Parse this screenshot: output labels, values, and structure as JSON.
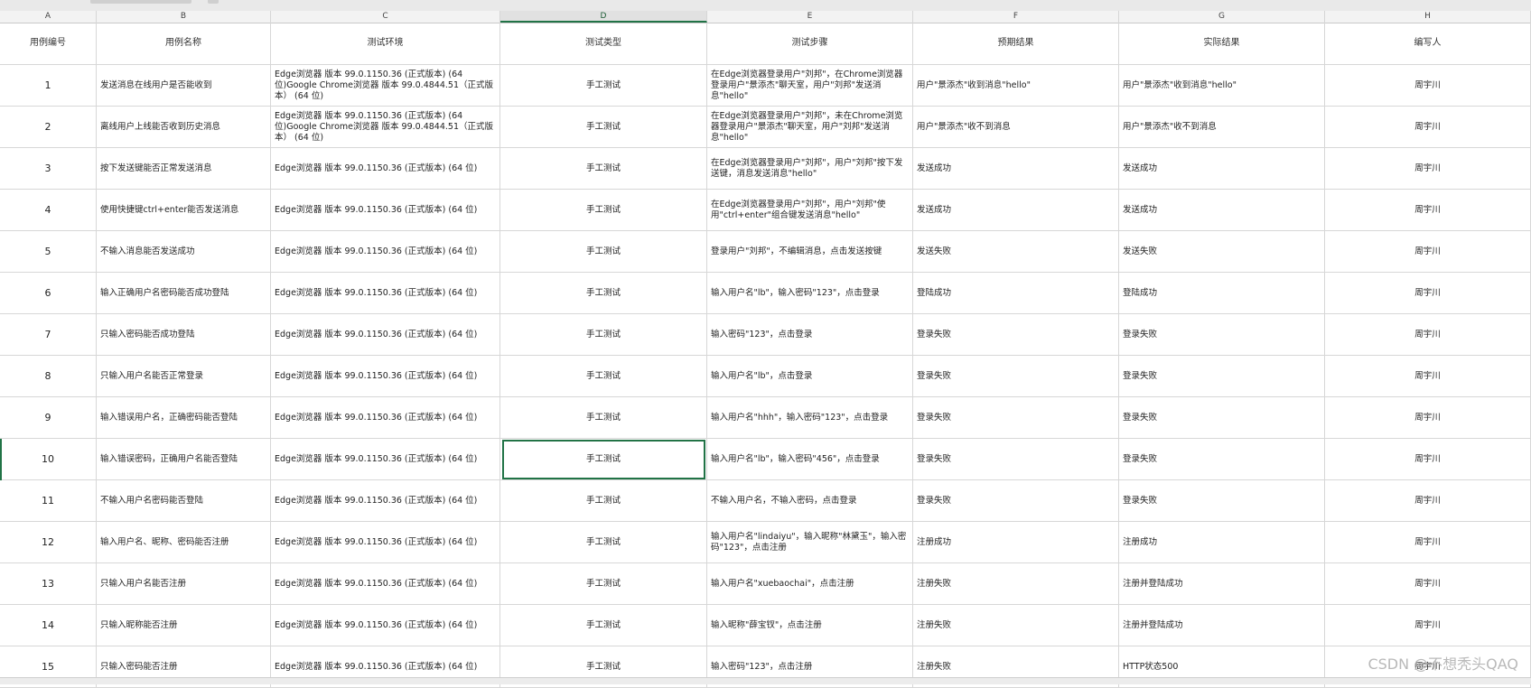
{
  "column_letters": [
    "A",
    "B",
    "C",
    "D",
    "E",
    "F",
    "G",
    "H"
  ],
  "selected_column": "D",
  "headers": [
    "用例编号",
    "用例名称",
    "测试环境",
    "测试类型",
    "测试步骤",
    "预期结果",
    "实际结果",
    "编写人"
  ],
  "rows": [
    {
      "id": "1",
      "name": "发送消息在线用户是否能收到",
      "env": "Edge浏览器 版本 99.0.1150.36 (正式版本) (64 位)Google Chrome浏览器 版本 99.0.4844.51（正式版本） (64 位)",
      "type": "手工测试",
      "steps": "在Edge浏览器登录用户\"刘邦\"，在Chrome浏览器登录用户\"景添杰\"聊天室，用户\"刘邦\"发送消息\"hello\"",
      "expected": "用户\"景添杰\"收到消息\"hello\"",
      "actual": "用户\"景添杰\"收到消息\"hello\"",
      "author": "周宇川"
    },
    {
      "id": "2",
      "name": "离线用户上线能否收到历史消息",
      "env": "Edge浏览器 版本 99.0.1150.36 (正式版本) (64 位)Google Chrome浏览器 版本 99.0.4844.51（正式版本） (64 位)",
      "type": "手工测试",
      "steps": "在Edge浏览器登录用户\"刘邦\"，未在Chrome浏览器登录用户\"景添杰\"聊天室，用户\"刘邦\"发送消息\"hello\"",
      "expected": "用户\"景添杰\"收不到消息",
      "actual": "用户\"景添杰\"收不到消息",
      "author": "周宇川"
    },
    {
      "id": "3",
      "name": "按下发送键能否正常发送消息",
      "env": "Edge浏览器 版本 99.0.1150.36 (正式版本) (64 位)",
      "type": "手工测试",
      "steps": "在Edge浏览器登录用户\"刘邦\"，用户\"刘邦\"按下发送键，消息发送消息\"hello\"",
      "expected": "发送成功",
      "actual": "发送成功",
      "author": "周宇川"
    },
    {
      "id": "4",
      "name": "使用快捷键ctrl+enter能否发送消息",
      "env": "Edge浏览器 版本 99.0.1150.36 (正式版本) (64 位)",
      "type": "手工测试",
      "steps": "在Edge浏览器登录用户\"刘邦\"，用户\"刘邦\"使用\"ctrl+enter\"组合键发送消息\"hello\"",
      "expected": "发送成功",
      "actual": "发送成功",
      "author": "周宇川"
    },
    {
      "id": "5",
      "name": "不输入消息能否发送成功",
      "env": "Edge浏览器 版本 99.0.1150.36 (正式版本) (64 位)",
      "type": "手工测试",
      "steps": "登录用户\"刘邦\"，不编辑消息，点击发送按键",
      "expected": "发送失败",
      "actual": "发送失败",
      "author": "周宇川"
    },
    {
      "id": "6",
      "name": "输入正确用户名密码能否成功登陆",
      "env": "Edge浏览器 版本 99.0.1150.36 (正式版本) (64 位)",
      "type": "手工测试",
      "steps": "输入用户名\"lb\"，输入密码\"123\"，点击登录",
      "expected": "登陆成功",
      "actual": "登陆成功",
      "author": "周宇川"
    },
    {
      "id": "7",
      "name": "只输入密码能否成功登陆",
      "env": "Edge浏览器 版本 99.0.1150.36 (正式版本) (64 位)",
      "type": "手工测试",
      "steps": "输入密码\"123\"，点击登录",
      "expected": "登录失败",
      "actual": "登录失败",
      "author": "周宇川"
    },
    {
      "id": "8",
      "name": "只输入用户名能否正常登录",
      "env": "Edge浏览器 版本 99.0.1150.36 (正式版本) (64 位)",
      "type": "手工测试",
      "steps": "输入用户名\"lb\"，点击登录",
      "expected": "登录失败",
      "actual": "登录失败",
      "author": "周宇川"
    },
    {
      "id": "9",
      "name": "输入错误用户名，正确密码能否登陆",
      "env": "Edge浏览器 版本 99.0.1150.36 (正式版本) (64 位)",
      "type": "手工测试",
      "steps": "输入用户名\"hhh\"，输入密码\"123\"，点击登录",
      "expected": "登录失败",
      "actual": "登录失败",
      "author": "周宇川"
    },
    {
      "id": "10",
      "name": "输入错误密码，正确用户名能否登陆",
      "env": "Edge浏览器 版本 99.0.1150.36 (正式版本) (64 位)",
      "type": "手工测试",
      "steps": "输入用户名\"lb\"，输入密码\"456\"，点击登录",
      "expected": "登录失败",
      "actual": "登录失败",
      "author": "周宇川"
    },
    {
      "id": "11",
      "name": "不输入用户名密码能否登陆",
      "env": "Edge浏览器 版本 99.0.1150.36 (正式版本) (64 位)",
      "type": "手工测试",
      "steps": "不输入用户名，不输入密码，点击登录",
      "expected": "登录失败",
      "actual": "登录失败",
      "author": "周宇川"
    },
    {
      "id": "12",
      "name": "输入用户名、昵称、密码能否注册",
      "env": "Edge浏览器 版本 99.0.1150.36 (正式版本) (64 位)",
      "type": "手工测试",
      "steps": "输入用户名\"lindaiyu\"，输入昵称\"林黛玉\"，输入密码\"123\"，点击注册",
      "expected": "注册成功",
      "actual": "注册成功",
      "author": "周宇川"
    },
    {
      "id": "13",
      "name": "只输入用户名能否注册",
      "env": "Edge浏览器 版本 99.0.1150.36 (正式版本) (64 位)",
      "type": "手工测试",
      "steps": "输入用户名\"xuebaochai\"，点击注册",
      "expected": "注册失败",
      "actual": "注册并登陆成功",
      "author": "周宇川"
    },
    {
      "id": "14",
      "name": "只输入昵称能否注册",
      "env": "Edge浏览器 版本 99.0.1150.36 (正式版本) (64 位)",
      "type": "手工测试",
      "steps": "输入昵称\"薛宝钗\"，点击注册",
      "expected": "注册失败",
      "actual": "注册并登陆成功",
      "author": "周宇川"
    },
    {
      "id": "15",
      "name": "只输入密码能否注册",
      "env": "Edge浏览器 版本 99.0.1150.36 (正式版本) (64 位)",
      "type": "手工测试",
      "steps": "输入密码\"123\"，点击注册",
      "expected": "注册失败",
      "actual": "HTTP状态500",
      "author": "周宇川"
    }
  ],
  "watermark": "CSDN @不想秃头QAQ"
}
